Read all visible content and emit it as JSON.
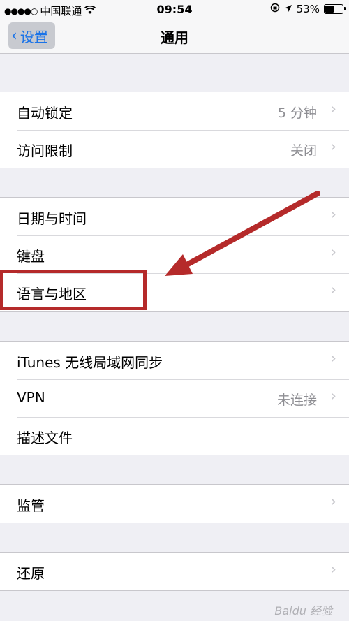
{
  "status_bar": {
    "carrier": "中国联通",
    "time": "09:54",
    "battery_text": "53%",
    "battery_level": 0.53,
    "signal_dots": "●●●●○"
  },
  "nav": {
    "back_label": "设置",
    "title": "通用"
  },
  "groups": [
    {
      "rows": [
        {
          "label": "自动锁定",
          "value": "5 分钟"
        },
        {
          "label": "访问限制",
          "value": "关闭"
        }
      ]
    },
    {
      "rows": [
        {
          "label": "日期与时间",
          "value": ""
        },
        {
          "label": "键盘",
          "value": ""
        },
        {
          "label": "语言与地区",
          "value": ""
        }
      ]
    },
    {
      "rows": [
        {
          "label": "iTunes 无线局域网同步",
          "value": ""
        },
        {
          "label": "VPN",
          "value": "未连接"
        },
        {
          "label": "描述文件",
          "value": ""
        }
      ]
    },
    {
      "rows": [
        {
          "label": "监管",
          "value": ""
        }
      ]
    },
    {
      "rows": [
        {
          "label": "还原",
          "value": ""
        }
      ]
    }
  ],
  "watermark": "Baidu 经验",
  "colors": {
    "accent": "#1a73e8",
    "annotation": "#b52a2a"
  }
}
